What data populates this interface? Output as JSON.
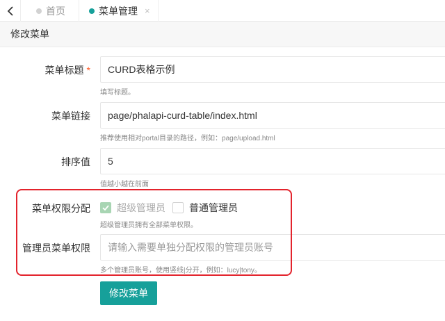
{
  "tabs": {
    "home_label": "首页",
    "active_label": "菜单管理",
    "close_glyph": "×"
  },
  "page": {
    "title": "修改菜单"
  },
  "form": {
    "title_field": {
      "label": "菜单标题",
      "required_mark": "*",
      "value": "CURD表格示例",
      "hint": "填写标题。"
    },
    "link_field": {
      "label": "菜单链接",
      "value": "page/phalapi-curd-table/index.html",
      "hint": "推荐使用相对portal目录的路径，例如：page/upload.html"
    },
    "order_field": {
      "label": "排序值",
      "value": "5",
      "hint": "值越小越在前面"
    },
    "permission_field": {
      "label": "菜单权限分配",
      "options": [
        {
          "label": "超级管理员",
          "checked": true,
          "disabled": true
        },
        {
          "label": "普通管理员",
          "checked": false,
          "disabled": false
        }
      ],
      "hint": "超级管理员拥有全部菜单权限。"
    },
    "admin_field": {
      "label": "管理员菜单权限",
      "value": "",
      "placeholder": "请输入需要单独分配权限的管理员账号",
      "hint": "多个管理员账号，使用竖线|分开，例如：lucy|tony。"
    },
    "submit_label": "修改菜单"
  },
  "colors": {
    "primary": "#16a09a",
    "checkbox_checked": "#5fb878",
    "required": "#ff5722",
    "highlight": "#e3232c"
  }
}
